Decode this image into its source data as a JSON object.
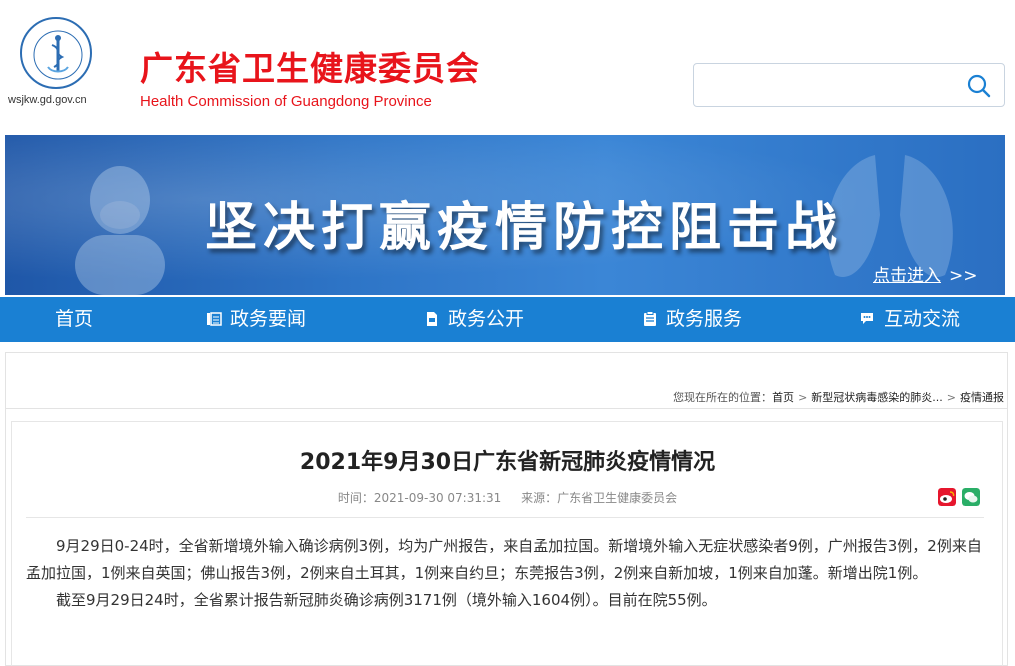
{
  "header": {
    "site_title": "广东省卫生健康委员会",
    "site_subtitle": "Health Commission of Guangdong Province",
    "domain": "wsjkw.gd.gov.cn",
    "search": {
      "value": "",
      "placeholder": ""
    }
  },
  "banner": {
    "title": "坚决打赢疫情防控阻击战",
    "link_label": "点击进入",
    "link_arrows": ">>"
  },
  "nav": {
    "items": [
      {
        "label": "首页",
        "icon": "home-icon"
      },
      {
        "label": "政务要闻",
        "icon": "news-icon"
      },
      {
        "label": "政务公开",
        "icon": "document-icon"
      },
      {
        "label": "政务服务",
        "icon": "clipboard-icon"
      },
      {
        "label": "互动交流",
        "icon": "chat-icon"
      }
    ]
  },
  "breadcrumb": {
    "prefix": "您现在所在的位置：",
    "items": [
      "首页",
      "新型冠状病毒感染的肺炎...",
      "疫情通报"
    ]
  },
  "article": {
    "title": "2021年9月30日广东省新冠肺炎疫情情况",
    "time_label": "时间：2021-09-30 07:31:31",
    "source_label": "来源：广东省卫生健康委员会",
    "paragraphs": [
      "9月29日0-24时，全省新增境外输入确诊病例3例，均为广州报告，来自孟加拉国。新增境外输入无症状感染者9例，广州报告3例，2例来自孟加拉国，1例来自英国；佛山报告3例，2例来自土耳其，1例来自约旦；东莞报告3例，2例来自新加坡，1例来自加蓬。新增出院1例。",
      "截至9月29日24时，全省累计报告新冠肺炎确诊病例3171例（境外输入1604例）。目前在院55例。"
    ]
  },
  "share": [
    "weibo-icon",
    "wechat-icon"
  ],
  "colors": {
    "brand_red": "#e8141b",
    "nav_blue": "#1a80d3",
    "banner_blue": "#2e75c7"
  }
}
